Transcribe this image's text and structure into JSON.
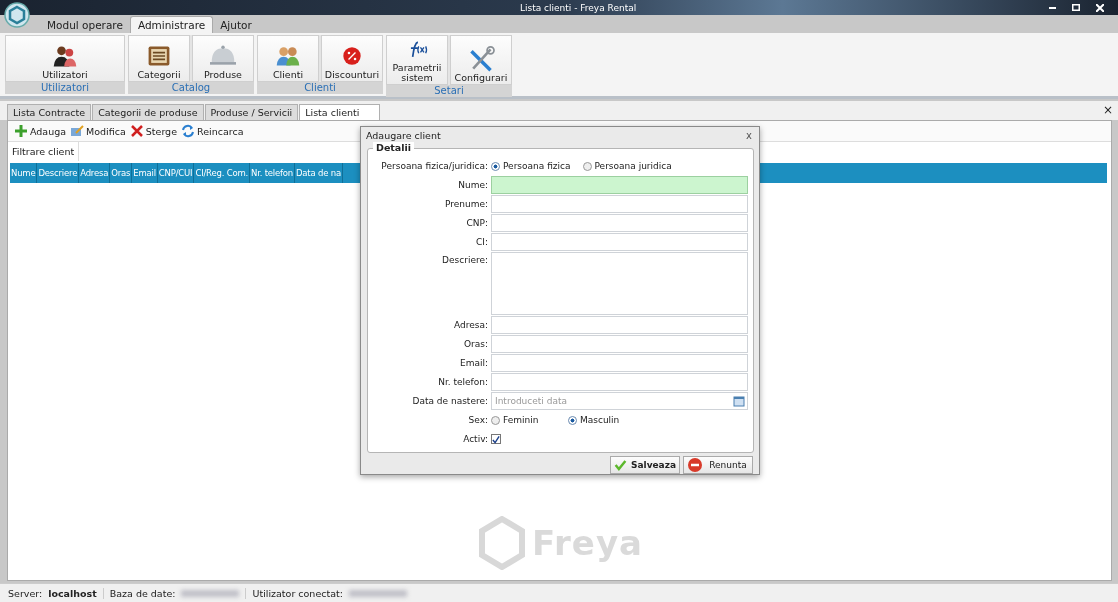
{
  "window": {
    "title": "Lista clienti - Freya Rental"
  },
  "ribbon_tabs": [
    {
      "label": "Modul operare",
      "selected": false
    },
    {
      "label": "Administrare",
      "selected": true
    },
    {
      "label": "Ajutor",
      "selected": false
    }
  ],
  "ribbon_groups": [
    {
      "label": "Utilizatori",
      "buttons": [
        "Utilizatori"
      ]
    },
    {
      "label": "Catalog",
      "buttons": [
        "Categorii",
        "Produse"
      ]
    },
    {
      "label": "Clienti",
      "buttons": [
        "Clienti",
        "Discounturi"
      ]
    },
    {
      "label": "Setari",
      "buttons": [
        "Parametrii sistem",
        "Configurari"
      ]
    }
  ],
  "doc_tabs": [
    {
      "label": "Lista Contracte",
      "selected": false
    },
    {
      "label": "Categorii de produse",
      "selected": false
    },
    {
      "label": "Produse / Servicii",
      "selected": false
    },
    {
      "label": "Lista clienti",
      "selected": true
    }
  ],
  "doc_close": "×",
  "toolbar": [
    "Adauga",
    "Modifica",
    "Sterge",
    "Reincarca"
  ],
  "filter_label": "Filtrare client",
  "table": {
    "columns": [
      "Nume",
      "Descriere",
      "Adresa",
      "Oras",
      "Email",
      "CNP/CUI",
      "CI/Reg. Com.",
      "Nr. telefon",
      "Data de na"
    ]
  },
  "dialog": {
    "title": "Adaugare client",
    "close": "x",
    "group": "Detalii",
    "person_type": {
      "label": "Persoana fizica/juridica:",
      "options": [
        {
          "label": "Persoana fizica",
          "selected": true
        },
        {
          "label": "Persoana juridica",
          "selected": false
        }
      ]
    },
    "fields": [
      {
        "label": "Nume:",
        "kind": "text",
        "focused": true
      },
      {
        "label": "Prenume:",
        "kind": "text",
        "focused": false
      },
      {
        "label": "CNP:",
        "kind": "text",
        "focused": false
      },
      {
        "label": "CI:",
        "kind": "text",
        "focused": false
      },
      {
        "label": "Descriere:",
        "kind": "textarea",
        "focused": false
      },
      {
        "label": "Adresa:",
        "kind": "text",
        "focused": false
      },
      {
        "label": "Oras:",
        "kind": "text",
        "focused": false
      },
      {
        "label": "Email:",
        "kind": "text",
        "focused": false
      },
      {
        "label": "Nr. telefon:",
        "kind": "text",
        "focused": false
      },
      {
        "label": "Data de nastere:",
        "kind": "date",
        "placeholder": "Introduceti data",
        "focused": false
      }
    ],
    "sex": {
      "label": "Sex:",
      "options": [
        {
          "label": "Feminin",
          "selected": false
        },
        {
          "label": "Masculin",
          "selected": true
        }
      ]
    },
    "active": {
      "label": "Activ:",
      "checked": true
    },
    "buttons": [
      {
        "label": "Salveaza",
        "kind": "save"
      },
      {
        "label": "Renunta",
        "kind": "cancel"
      }
    ]
  },
  "logo": "Freya",
  "status_bar": {
    "server_label": "Server:",
    "server": "localhost",
    "db_label": "Baza de date:",
    "user_label": "Utilizator conectat:"
  }
}
